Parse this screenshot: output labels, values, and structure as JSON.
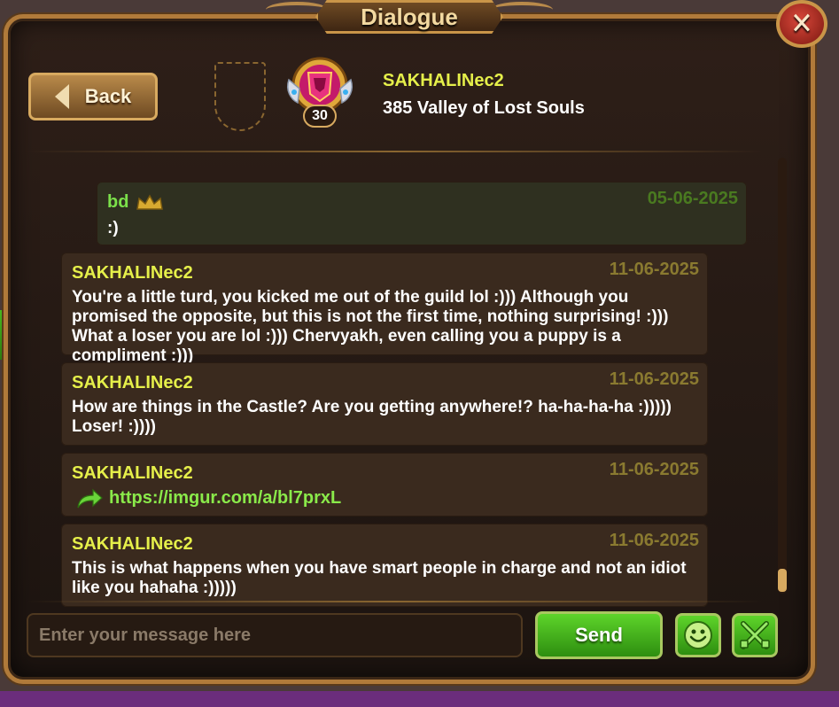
{
  "window": {
    "title": "Dialogue",
    "close_symbol": "✕"
  },
  "header": {
    "back_label": "Back",
    "player_name": "SAKHALINec2",
    "guild_name": "385 Valley of Lost Souls",
    "guild_level": "30"
  },
  "messages": [
    {
      "author": "bd",
      "date": "05-06-2025",
      "text": ":)",
      "is_self": true,
      "badge_icon": "crown-icon"
    },
    {
      "author": "SAKHALINec2",
      "date": "11-06-2025",
      "text": "You're a little turd, you kicked me out of the guild lol :))) Although you promised the opposite, but this is not the first time, nothing surprising! :))) What a loser you are lol :))) Chervyakh, even calling you a puppy is a compliment :)))"
    },
    {
      "author": "SAKHALINec2",
      "date": "11-06-2025",
      "text": "How are things in the Castle? Are you getting anywhere!? ha-ha-ha-ha :))))) Loser! :))))"
    },
    {
      "author": "SAKHALINec2",
      "date": "11-06-2025",
      "link": "https://imgur.com/a/bl7prxL",
      "link_icon": "share-arrow-icon"
    },
    {
      "author": "SAKHALINec2",
      "date": "11-06-2025",
      "text": "This is what happens when you have smart people in charge and not an idiot like you hahaha :)))))"
    }
  ],
  "composer": {
    "placeholder": "Enter your message here",
    "value": "",
    "send_label": "Send",
    "emoji_icon": "smiley-icon",
    "block_icon": "crossed-swords-icon"
  },
  "colors": {
    "player_name": "#e5ef4a",
    "self_author": "#7be04a",
    "link": "#8aea4a",
    "frame_gold": "#b07a3a",
    "button_green": "#3fae1a"
  }
}
